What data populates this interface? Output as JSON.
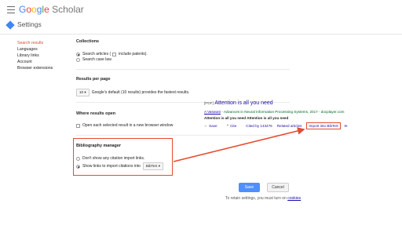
{
  "header": {
    "logo_letters": [
      "G",
      "o",
      "o",
      "g",
      "l",
      "e"
    ],
    "logo_rest": " Scholar",
    "page_title": "Settings"
  },
  "sidebar": {
    "items": [
      {
        "label": "Search results",
        "active": true
      },
      {
        "label": "Languages",
        "active": false
      },
      {
        "label": "Library links",
        "active": false
      },
      {
        "label": "Account",
        "active": false
      },
      {
        "label": "Browser extensions",
        "active": false
      }
    ]
  },
  "collections": {
    "title": "Collections",
    "option_articles": "Search articles (",
    "option_articles_patents": "include patents).",
    "option_caselaw": "Search case law."
  },
  "results_per_page": {
    "title": "Results per page",
    "value": "10",
    "note": "Google's default (10 results) provides the fastest results."
  },
  "where_results_open": {
    "title": "Where results open",
    "option": "Open each selected result in a new browser window"
  },
  "bibliography": {
    "title": "Bibliography manager",
    "option_none": "Don't show any citation import links.",
    "option_show": "Show links to import citations into",
    "format": "BibTeX"
  },
  "sample_result": {
    "tag": "[PDF]",
    "title": "Attention is all you need",
    "source_link": "A Vaswani",
    "source_rest": " - Advances in Neural Information Processing Systems, 2017 - docplayer.com",
    "snippet": "Attention is all you need Attention is all you need",
    "save": "Save",
    "cite": "Cite",
    "cited_by": "Cited by 143476",
    "related": "Related articles",
    "import_bibtex": "Import into BibTeX",
    "more": "≫"
  },
  "buttons": {
    "save": "Save",
    "cancel": "Cancel"
  },
  "footer": {
    "note": "To retain settings, you must turn on ",
    "cookies": "cookies"
  },
  "colors": {
    "accent_red": "#e54b33",
    "link_blue": "#1a0dab",
    "save_blue": "#4d90fe",
    "source_green": "#006621"
  }
}
